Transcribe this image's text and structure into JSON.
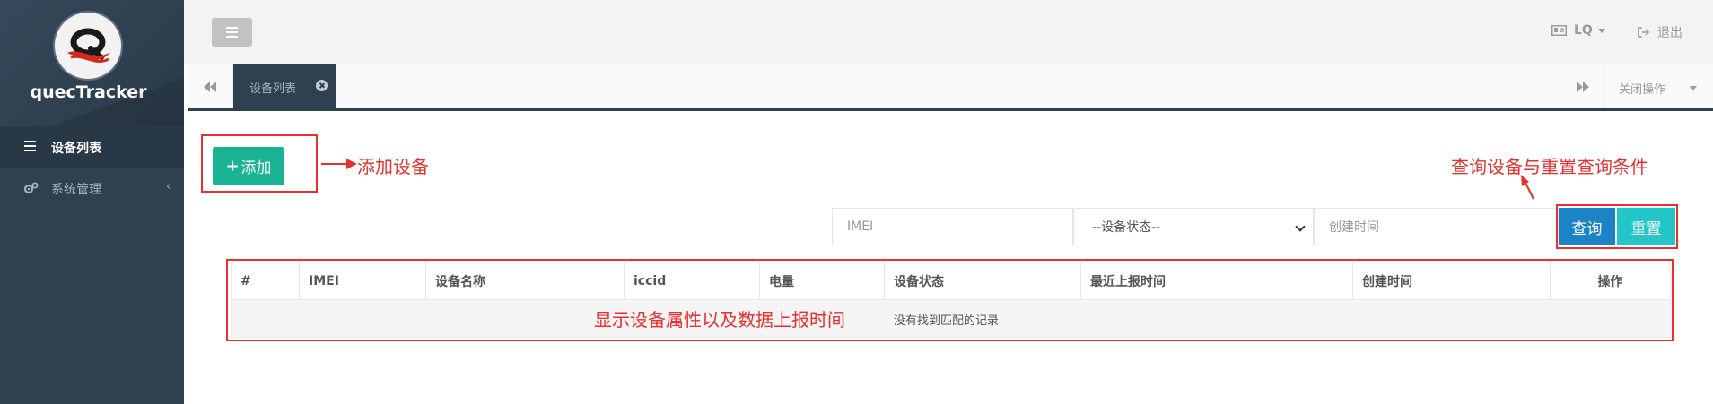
{
  "sidebar": {
    "brand": "quecTracker",
    "items": [
      {
        "label": "设备列表",
        "icon": "list-icon",
        "active": true
      },
      {
        "label": "系统管理",
        "icon": "gears-icon",
        "active": false
      }
    ]
  },
  "header": {
    "user": "LQ",
    "logout": "退出"
  },
  "tabs": {
    "active_tab": "设备列表",
    "close_ops": "关闭操作"
  },
  "toolbar": {
    "add_label": "添加",
    "add_plus": "+"
  },
  "search": {
    "imei_placeholder": "IMEI",
    "status_select": "--设备状态--",
    "created_placeholder": "创建时间",
    "query_label": "查询",
    "reset_label": "重置"
  },
  "table": {
    "columns": [
      "#",
      "IMEI",
      "设备名称",
      "iccid",
      "电量",
      "设备状态",
      "最近上报时间",
      "创建时间",
      "操作"
    ],
    "empty_text": "没有找到匹配的记录"
  },
  "annotations": {
    "add_device": "添加设备",
    "query_reset": "查询设备与重置查询条件",
    "table_desc": "显示设备属性以及数据上报时间"
  },
  "colors": {
    "sidebar_bg": "#2f4050",
    "add_button": "#1ab394",
    "query_button": "#1c84c6",
    "reset_button": "#23c6c8",
    "annotation": "#e8312e"
  }
}
